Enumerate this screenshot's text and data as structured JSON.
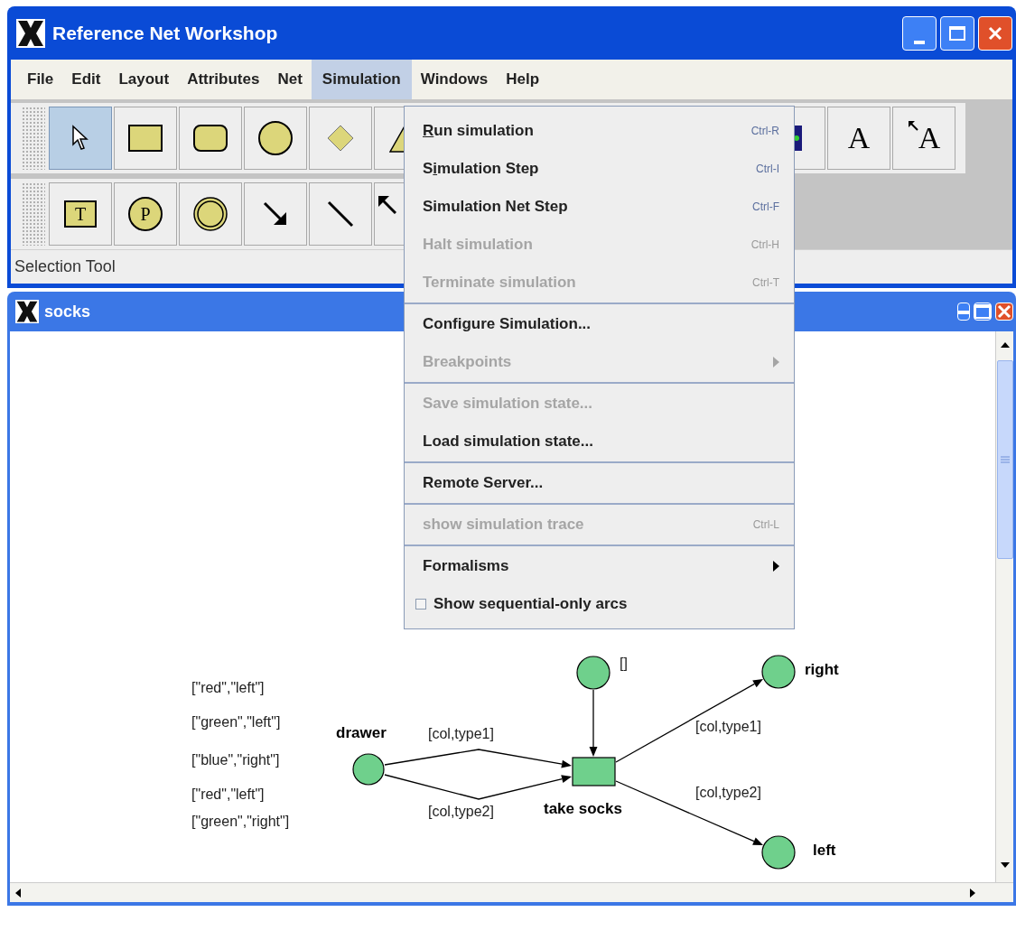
{
  "main_window": {
    "title": "Reference Net Workshop"
  },
  "menubar": [
    {
      "label": "File",
      "selected": false
    },
    {
      "label": "Edit",
      "selected": false
    },
    {
      "label": "Layout",
      "selected": false
    },
    {
      "label": "Attributes",
      "selected": false
    },
    {
      "label": "Net",
      "selected": false
    },
    {
      "label": "Simulation",
      "selected": true
    },
    {
      "label": "Windows",
      "selected": false
    },
    {
      "label": "Help",
      "selected": false
    }
  ],
  "toolbar_row_1": {
    "start": [
      {
        "kind": "selection",
        "selected": true
      },
      {
        "kind": "rectangle",
        "selected": false
      },
      {
        "kind": "round-rectangle",
        "selected": false
      },
      {
        "kind": "ellipse",
        "selected": false
      },
      {
        "kind": "diamond",
        "selected": false
      },
      {
        "kind": "triangle",
        "selected": false
      }
    ],
    "end": [
      {
        "kind": "color",
        "selected": false
      },
      {
        "kind": "text",
        "label": "A",
        "selected": false
      },
      {
        "kind": "connected-text",
        "label": "A",
        "selected": false
      }
    ]
  },
  "toolbar_row_2": {
    "start": [
      {
        "kind": "transition",
        "label": "T",
        "selected": false
      },
      {
        "kind": "place",
        "label": "P",
        "selected": false
      },
      {
        "kind": "virtual-place",
        "selected": false
      },
      {
        "kind": "arc",
        "selected": false
      },
      {
        "kind": "line",
        "selected": false
      },
      {
        "kind": "inhibitor",
        "selected": false
      }
    ]
  },
  "status_bar": "Selection Tool",
  "net_window": {
    "title": "socks"
  },
  "open_menu": {
    "items": [
      {
        "kind": "item",
        "mnemonic": "R",
        "label_rest": "un simulation",
        "shortcut": "Ctrl-R",
        "disabled": false
      },
      {
        "kind": "item",
        "label_start": "S",
        "mnemonic": "i",
        "label_rest": "mulation Step",
        "shortcut": "Ctrl-I",
        "disabled": false
      },
      {
        "kind": "item",
        "label": "Simulation Net Step",
        "shortcut": "Ctrl-F",
        "disabled": false
      },
      {
        "kind": "item",
        "label": "Halt simulation",
        "shortcut": "Ctrl-H",
        "disabled": true
      },
      {
        "kind": "item",
        "label": "Terminate simulation",
        "shortcut": "Ctrl-T",
        "disabled": true
      },
      {
        "kind": "separator"
      },
      {
        "kind": "item",
        "label": "Configure Simulation...",
        "disabled": false
      },
      {
        "kind": "submenu",
        "label": "Breakpoints",
        "disabled": true
      },
      {
        "kind": "separator"
      },
      {
        "kind": "item",
        "label": "Save simulation state...",
        "disabled": true
      },
      {
        "kind": "item",
        "label": "Load simulation state...",
        "disabled": false
      },
      {
        "kind": "separator"
      },
      {
        "kind": "item",
        "label": "Remote Server...",
        "disabled": false
      },
      {
        "kind": "separator"
      },
      {
        "kind": "item",
        "label": "show simulation trace",
        "shortcut": "Ctrl-L",
        "disabled": true
      },
      {
        "kind": "separator"
      },
      {
        "kind": "submenu",
        "label": "Formalisms",
        "disabled": false
      },
      {
        "kind": "checkbox",
        "label": "Show sequential-only arcs",
        "checked": false,
        "disabled": false
      }
    ]
  },
  "net": {
    "places": [
      {
        "name": "drawer",
        "marking": [
          "[\"red\",\"left\"]",
          "[\"green\",\"left\"]",
          "[\"blue\",\"right\"]",
          "[\"red\",\"left\"]",
          "[\"green\",\"right\"]"
        ]
      },
      {
        "marking": [
          "[]"
        ]
      },
      {
        "name": "right"
      },
      {
        "name": "left"
      }
    ],
    "transition": {
      "name": "take socks"
    },
    "arcs": [
      {
        "inscription": "[col,type1]"
      },
      {
        "inscription": "[col,type2]"
      },
      {
        "inscription": "[col,type1]"
      },
      {
        "inscription": "[col,type2]"
      }
    ]
  }
}
